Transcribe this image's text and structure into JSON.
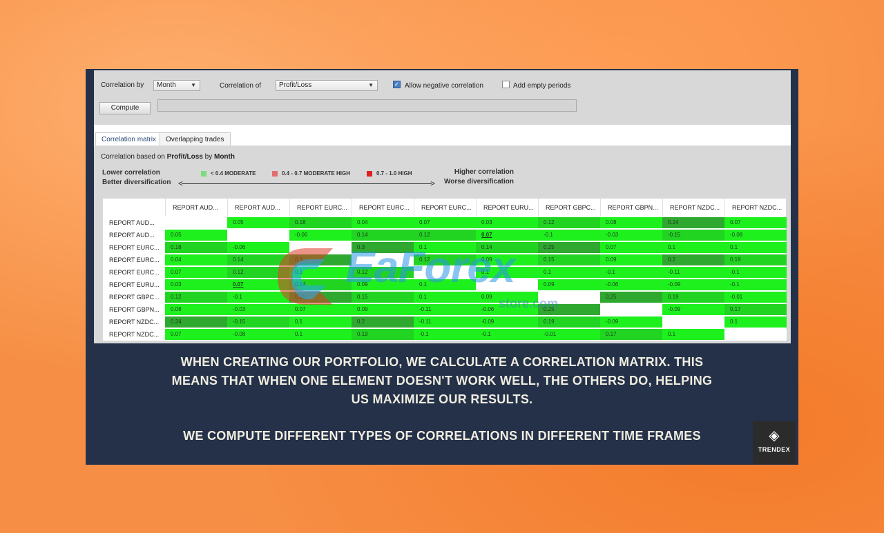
{
  "toolbar": {
    "correlation_by_label": "Correlation by",
    "correlation_by_value": "Month",
    "correlation_of_label": "Correlation of",
    "correlation_of_value": "Profit/Loss",
    "allow_negative_label": "Allow negative correlation",
    "allow_negative_checked": true,
    "add_empty_label": "Add empty periods",
    "add_empty_checked": false,
    "compute_label": "Compute"
  },
  "tabs": [
    {
      "label": "Correlation matrix",
      "active": true
    },
    {
      "label": "Overlapping trades",
      "active": false
    }
  ],
  "subtitle": {
    "prefix": "Correlation based on",
    "metric": "Profit/Loss",
    "by": "by",
    "period": "Month"
  },
  "legend": {
    "lower_line1": "Lower correlation",
    "lower_line2": "Better diversification",
    "higher_line1": "Higher correlation",
    "higher_line2": "Worse diversification",
    "items": [
      {
        "label": "< 0.4 MODERATE",
        "color": "#7ddc7d"
      },
      {
        "label": "0.4 - 0.7 MODERATE HIGH",
        "color": "#e07070"
      },
      {
        "label": "0.7 - 1.0 HIGH",
        "color": "#e02020"
      }
    ]
  },
  "matrix": {
    "columns": [
      "REPORT AUD...",
      "REPORT AUD...",
      "REPORT EURC...",
      "REPORT EURC...",
      "REPORT EURC...",
      "REPORT EURU...",
      "REPORT GBPC...",
      "REPORT GBPN...",
      "REPORT NZDC...",
      "REPORT NZDC..."
    ],
    "rows": [
      "REPORT AUD...",
      "REPORT AUD...",
      "REPORT EURC...",
      "REPORT EURC...",
      "REPORT EURC...",
      "REPORT EURU...",
      "REPORT GBPC...",
      "REPORT GBPN...",
      "REPORT NZDC...",
      "REPORT NZDC..."
    ],
    "values": [
      [
        "",
        "0.05",
        "0.18",
        "0.04",
        "0.07",
        "0.03",
        "0.12",
        "0.08",
        "0.24",
        "0.07"
      ],
      [
        "0.05",
        "",
        "-0.06",
        "0.14",
        "0.12",
        "0.07",
        "-0.1",
        "-0.03",
        "-0.15",
        "-0.08"
      ],
      [
        "0.18",
        "-0.06",
        "",
        "0.3",
        "0.1",
        "0.14",
        "0.25",
        "0.07",
        "0.1",
        "0.1"
      ],
      [
        "0.04",
        "0.14",
        "0.3",
        "",
        "0.12",
        "0.09",
        "0.15",
        "0.09",
        "0.2",
        "0.19"
      ],
      [
        "0.07",
        "0.12",
        "0.1",
        "0.12",
        "",
        "0.1",
        "0.1",
        "-0.1",
        "-0.11",
        "-0.1"
      ],
      [
        "0.03",
        "0.07",
        "0.14",
        "0.09",
        "0.1",
        "",
        "0.09",
        "-0.06",
        "-0.09",
        "-0.1"
      ],
      [
        "0.12",
        "-0.1",
        "0.25",
        "0.15",
        "0.1",
        "0.09",
        "",
        "0.25",
        "0.19",
        "-0.01"
      ],
      [
        "0.08",
        "-0.03",
        "0.07",
        "0.09",
        "-0.11",
        "-0.06",
        "0.25",
        "",
        "-0.09",
        "0.17"
      ],
      [
        "0.24",
        "-0.15",
        "0.1",
        "0.2",
        "-0.11",
        "-0.09",
        "0.19",
        "-0.09",
        "",
        "0.1"
      ],
      [
        "0.07",
        "-0.08",
        "0.1",
        "0.19",
        "-0.1",
        "-0.1",
        "-0.01",
        "0.17",
        "0.1",
        ""
      ]
    ],
    "underlined": [
      [
        1,
        5
      ],
      [
        5,
        1
      ]
    ]
  },
  "watermark": {
    "text": "EaForex",
    "sub": "store.com"
  },
  "caption": {
    "line1": "WHEN CREATING OUR PORTFOLIO, WE CALCULATE A CORRELATION MATRIX. THIS MEANS THAT WHEN ONE ELEMENT DOESN'T WORK WELL, THE OTHERS DO, HELPING US MAXIMIZE OUR RESULTS.",
    "line2": "WE COMPUTE DIFFERENT TYPES OF CORRELATIONS IN DIFFERENT TIME FRAMES"
  },
  "logo": {
    "brand": "TRENDEX",
    "icon": "trendex-logo-icon"
  }
}
